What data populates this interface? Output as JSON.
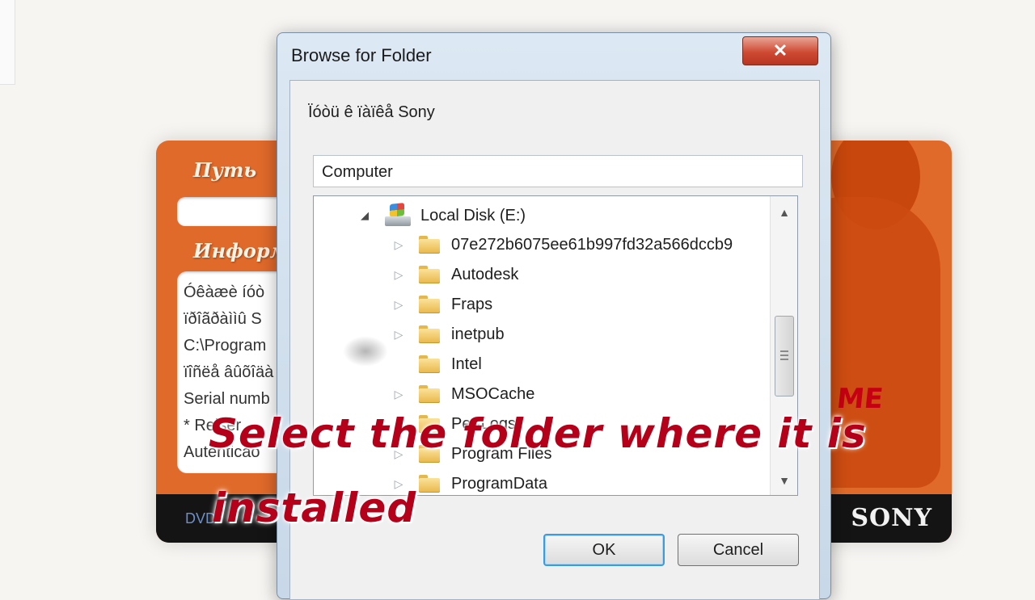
{
  "background_app": {
    "path_label": "Путь",
    "info_label": "Информ",
    "info_lines": [
      "Óêàæè íóò",
      "ïðîãðàììû S",
      "C:\\Program",
      "ïîñëå âûõîäà",
      "Serial numb",
      "* Reiser",
      "Autenticao"
    ],
    "bottom_left": "DVD",
    "brand": "SONY",
    "badge": "ME",
    "accent_color": "#e06a2a"
  },
  "dialog": {
    "title": "Browse for Folder",
    "close_icon": "close-icon",
    "prompt": "Ïóòü ê ïàïêå Sony",
    "selected_path": "Computer",
    "tree": {
      "drive": {
        "label": "Local Disk (E:)",
        "expanded": true
      },
      "folders": [
        {
          "label": "07e272b6075ee61b997fd32a566dccb9",
          "has_children": true
        },
        {
          "label": "Autodesk",
          "has_children": true
        },
        {
          "label": "Fraps",
          "has_children": true
        },
        {
          "label": "inetpub",
          "has_children": true
        },
        {
          "label": "Intel",
          "has_children": false
        },
        {
          "label": "MSOCache",
          "has_children": true
        },
        {
          "label": "PerfLogs",
          "has_children": false
        },
        {
          "label": "Program Files",
          "has_children": true
        },
        {
          "label": "ProgramData",
          "has_children": true
        }
      ]
    },
    "ok_label": "OK",
    "cancel_label": "Cancel"
  },
  "overlay": {
    "caption_line1": "Select the folder where it is",
    "caption_line2": "installed",
    "caption_color": "#b5001a"
  }
}
